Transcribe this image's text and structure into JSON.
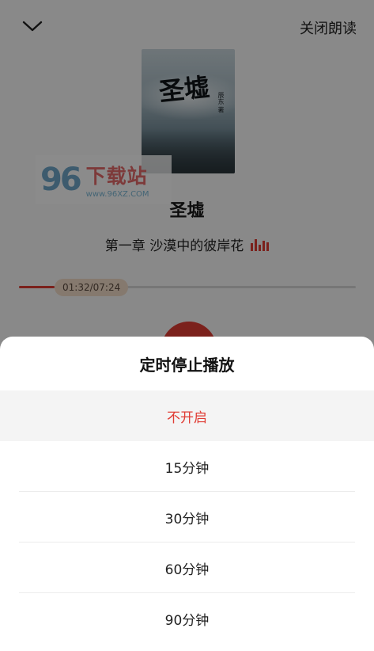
{
  "header": {
    "collapse_icon": "chevron-down-icon",
    "close_reading_label": "关闭朗读"
  },
  "book": {
    "cover_title": "圣墟",
    "cover_author": "辰东 著",
    "title": "圣墟",
    "chapter": "第一章 沙漠中的彼岸花"
  },
  "watermark": {
    "number": "96",
    "name": "下载站",
    "url": "www.96XZ.COM"
  },
  "progress": {
    "time": "01:32/07:24",
    "fraction": 0.21
  },
  "sheet": {
    "title": "定时停止播放",
    "options": [
      {
        "label": "不开启",
        "selected": true
      },
      {
        "label": "15分钟",
        "selected": false
      },
      {
        "label": "30分钟",
        "selected": false
      },
      {
        "label": "60分钟",
        "selected": false
      },
      {
        "label": "90分钟",
        "selected": false
      }
    ]
  },
  "colors": {
    "accent": "#e03c34",
    "overlay": "rgba(0,0,0,0.45)"
  }
}
